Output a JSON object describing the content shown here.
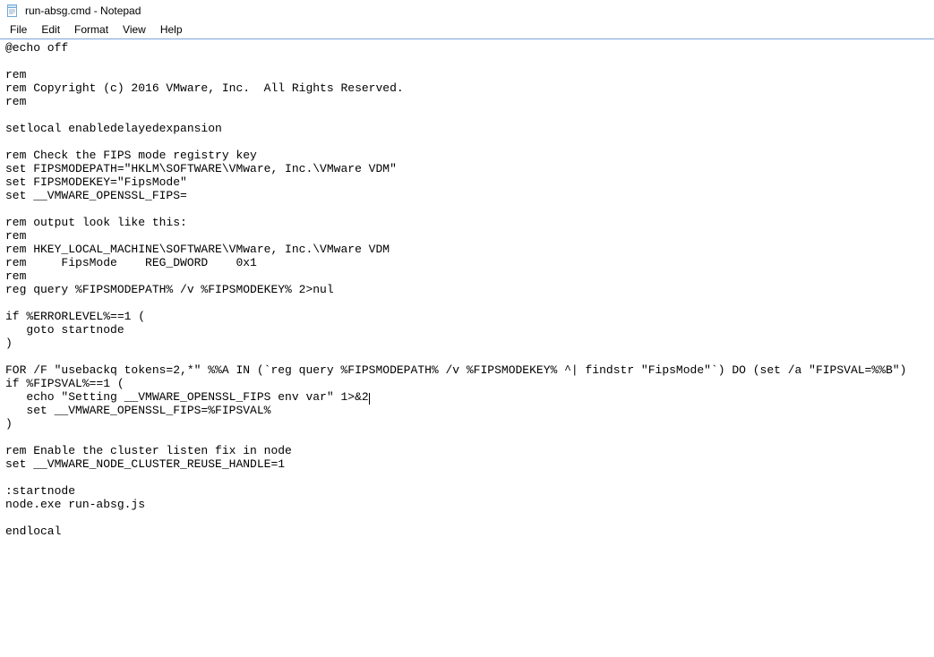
{
  "window": {
    "title": "run-absg.cmd - Notepad"
  },
  "menu": {
    "file": "File",
    "edit": "Edit",
    "format": "Format",
    "view": "View",
    "help": "Help"
  },
  "editor": {
    "lines": [
      "@echo off",
      "",
      "rem",
      "rem Copyright (c) 2016 VMware, Inc.  All Rights Reserved.",
      "rem",
      "",
      "setlocal enabledelayedexpansion",
      "",
      "rem Check the FIPS mode registry key",
      "set FIPSMODEPATH=\"HKLM\\SOFTWARE\\VMware, Inc.\\VMware VDM\"",
      "set FIPSMODEKEY=\"FipsMode\"",
      "set __VMWARE_OPENSSL_FIPS=",
      "",
      "rem output look like this:",
      "rem",
      "rem HKEY_LOCAL_MACHINE\\SOFTWARE\\VMware, Inc.\\VMware VDM",
      "rem     FipsMode    REG_DWORD    0x1",
      "rem",
      "reg query %FIPSMODEPATH% /v %FIPSMODEKEY% 2>nul",
      "",
      "if %ERRORLEVEL%==1 (",
      "   goto startnode",
      ")",
      "",
      "FOR /F \"usebackq tokens=2,*\" %%A IN (`reg query %FIPSMODEPATH% /v %FIPSMODEKEY% ^| findstr \"FipsMode\"`) DO (set /a \"FIPSVAL=%%B\")",
      "if %FIPSVAL%==1 (",
      "   echo \"Setting __VMWARE_OPENSSL_FIPS env var\" 1>&2",
      "   set __VMWARE_OPENSSL_FIPS=%FIPSVAL%",
      ")",
      "",
      "rem Enable the cluster listen fix in node",
      "set __VMWARE_NODE_CLUSTER_REUSE_HANDLE=1",
      "",
      ":startnode",
      "node.exe run-absg.js",
      "",
      "endlocal"
    ],
    "caret_line": 26,
    "caret_col_after": "   echo \"Setting __VMWARE_OPENSSL_FIPS env var\" 1>&2"
  }
}
